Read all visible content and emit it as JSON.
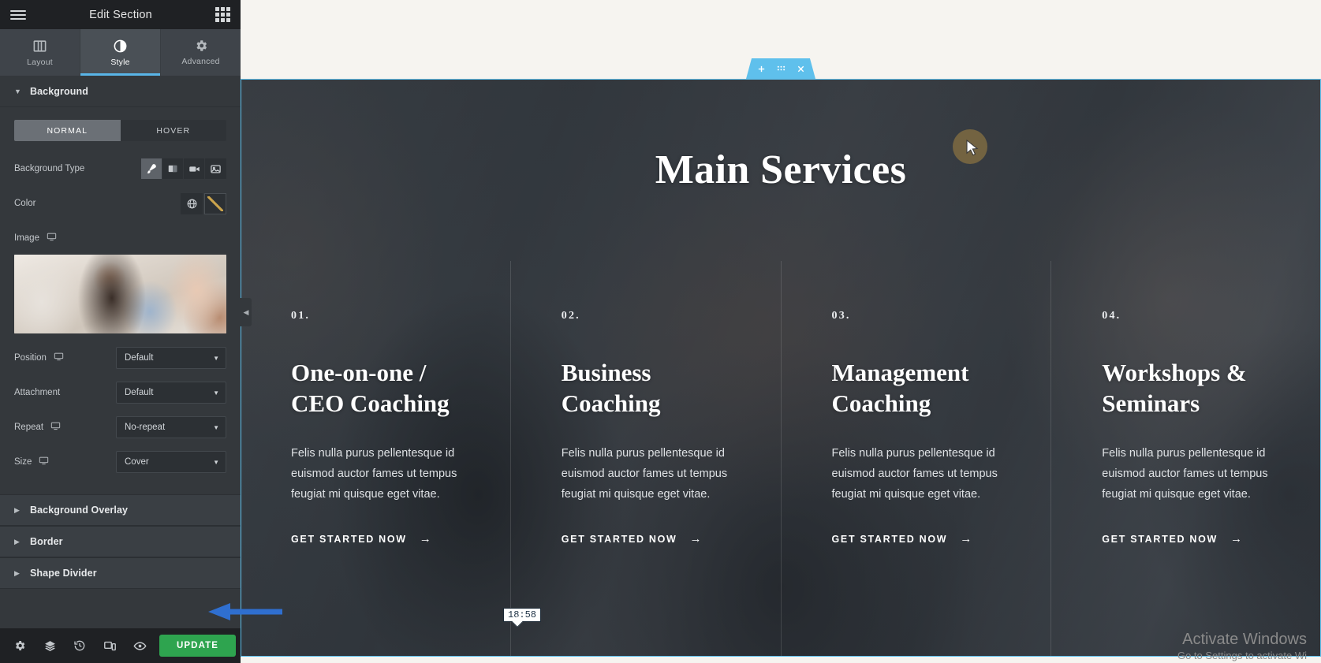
{
  "panel": {
    "title": "Edit Section",
    "menu_icon": "hamburger-icon",
    "apps_icon": "apps-grid-icon",
    "tabs": [
      {
        "label": "Layout",
        "icon": "layout-icon",
        "active": false
      },
      {
        "label": "Style",
        "icon": "contrast-icon",
        "active": true
      },
      {
        "label": "Advanced",
        "icon": "gear-icon",
        "active": false
      }
    ],
    "sections": [
      {
        "title": "Background",
        "expanded": true
      },
      {
        "title": "Background Overlay",
        "expanded": false
      },
      {
        "title": "Border",
        "expanded": false
      },
      {
        "title": "Shape Divider",
        "expanded": false
      }
    ],
    "background": {
      "state_tabs": [
        {
          "label": "NORMAL",
          "active": true
        },
        {
          "label": "HOVER",
          "active": false
        }
      ],
      "background_type_label": "Background Type",
      "background_types": [
        {
          "name": "classic-brush-icon",
          "active": true
        },
        {
          "name": "gradient-icon",
          "active": false
        },
        {
          "name": "video-icon",
          "active": false
        },
        {
          "name": "slideshow-icon",
          "active": false
        }
      ],
      "color_label": "Color",
      "color_buttons": [
        {
          "name": "global-color-icon"
        },
        {
          "name": "color-swatch-gradient"
        }
      ],
      "image_label": "Image",
      "image_alt": "office-team-photo-thumbnail",
      "fields": [
        {
          "label": "Position",
          "value": "Default",
          "responsive": true
        },
        {
          "label": "Attachment",
          "value": "Default",
          "responsive": false
        },
        {
          "label": "Repeat",
          "value": "No-repeat",
          "responsive": true
        },
        {
          "label": "Size",
          "value": "Cover",
          "responsive": true
        }
      ]
    },
    "footer": {
      "icons": [
        {
          "name": "settings-gear-icon"
        },
        {
          "name": "navigator-layers-icon"
        },
        {
          "name": "history-icon"
        },
        {
          "name": "responsive-mode-icon"
        },
        {
          "name": "preview-eye-icon"
        }
      ],
      "update_label": "UPDATE"
    },
    "collapse_icon": "chevron-left-icon"
  },
  "canvas": {
    "section_handle": {
      "add_icon": "plus-icon",
      "drag_icon": "drag-dots-icon",
      "close_icon": "close-x-icon"
    },
    "hero": {
      "title": "Main Services",
      "cards": [
        {
          "number": "01.",
          "title": "One-on-one /\nCEO Coaching",
          "description": "Felis nulla purus pellentesque id euismod auctor fames ut tempus feugiat mi quisque eget vitae.",
          "cta": "GET STARTED NOW",
          "cta_icon": "arrow-right-icon"
        },
        {
          "number": "02.",
          "title": "Business\nCoaching",
          "description": "Felis nulla purus pellentesque id euismod auctor fames ut tempus feugiat mi quisque eget vitae.",
          "cta": "GET STARTED NOW",
          "cta_icon": "arrow-right-icon"
        },
        {
          "number": "03.",
          "title": "Management\nCoaching",
          "description": "Felis nulla purus pellentesque id euismod auctor fames ut tempus feugiat mi quisque eget vitae.",
          "cta": "GET STARTED NOW",
          "cta_icon": "arrow-right-icon"
        },
        {
          "number": "04.",
          "title": "Workshops &\nSeminars",
          "description": "Felis nulla purus pellentesque id euismod auctor fames ut tempus feugiat mi quisque eget vitae.",
          "cta": "GET STARTED NOW",
          "cta_icon": "arrow-right-icon"
        }
      ]
    }
  },
  "overlays": {
    "time_tooltip": "18:58",
    "watermark_line1": "Activate Windows",
    "watermark_line2": "Go to Settings to activate Wi",
    "cursor_icon": "mouse-pointer-icon",
    "annotation_icon": "blue-arrow-icon"
  },
  "colors": {
    "panel_bg": "#34383c",
    "panel_header_bg": "#1f2124",
    "accent_blue": "#59b5e8",
    "update_green": "#2ea44f",
    "section_handle": "#5fc0ec",
    "annotation_blue": "#2f6fd0"
  }
}
